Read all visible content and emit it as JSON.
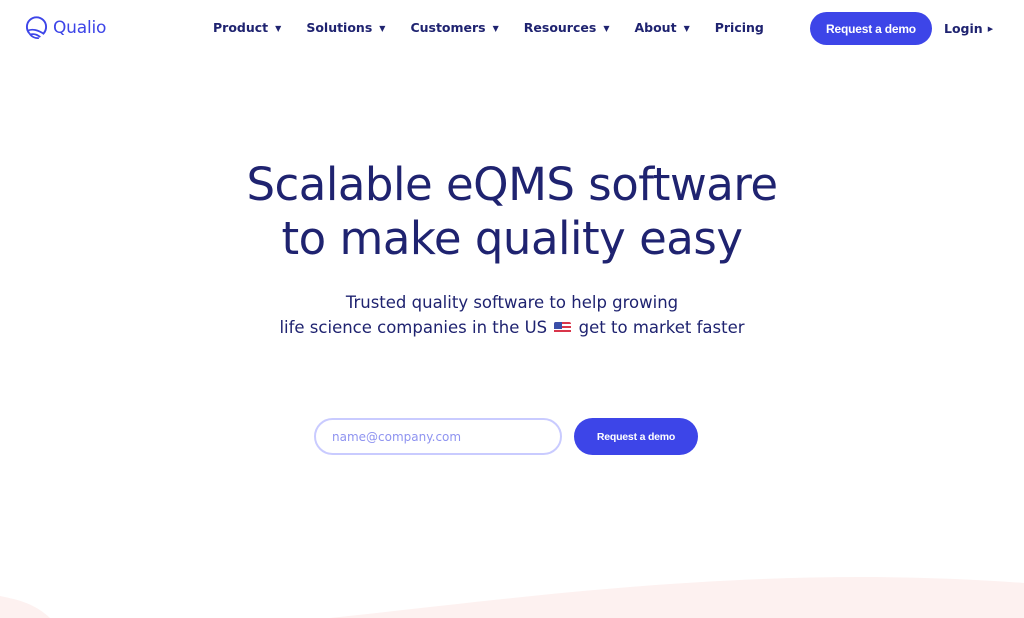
{
  "header": {
    "logo_text": "Qualio",
    "nav": [
      {
        "label": "Product",
        "has_dropdown": true
      },
      {
        "label": "Solutions",
        "has_dropdown": true
      },
      {
        "label": "Customers",
        "has_dropdown": true
      },
      {
        "label": "Resources",
        "has_dropdown": true
      },
      {
        "label": "About",
        "has_dropdown": true
      },
      {
        "label": "Pricing",
        "has_dropdown": false
      }
    ],
    "demo_button": "Request a demo",
    "login_label": "Login",
    "dropdown_glyph": "▼",
    "login_glyph": "▶"
  },
  "hero": {
    "title_line1": "Scalable eQMS software",
    "title_line2": "to make quality easy",
    "subtitle_line1": "Trusted quality software to help growing",
    "subtitle_line2_before": "life science companies in the US",
    "subtitle_flag_icon": "us-flag-icon",
    "subtitle_line2_after": "get to market faster"
  },
  "form": {
    "email_placeholder": "name@company.com",
    "email_value": "",
    "submit_label": "Request a demo"
  },
  "colors": {
    "brand": "#3d45e8",
    "navy_text": "#1f2370",
    "input_border": "#c9cbff",
    "wave_fill": "#fdf1f0"
  }
}
